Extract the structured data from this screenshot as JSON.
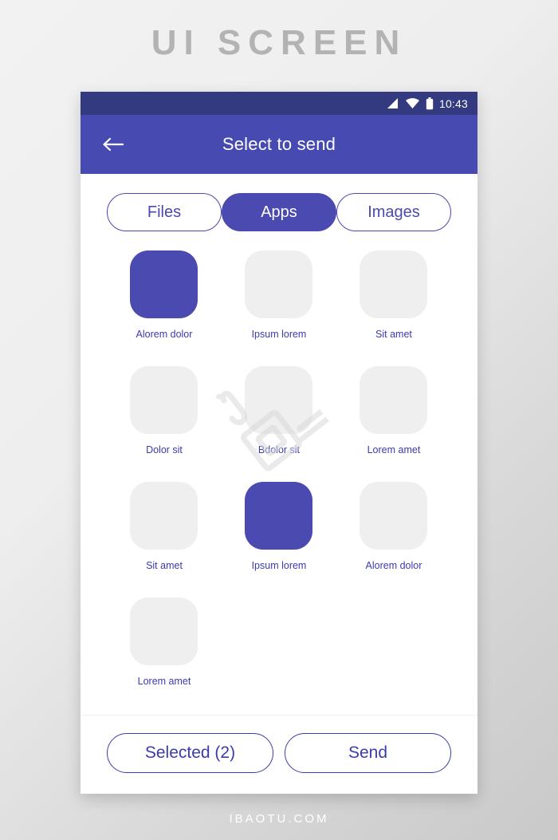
{
  "page": {
    "heading": "UI SCREEN",
    "site_watermark": "IBAOTU.COM"
  },
  "colors": {
    "status_bar": "#333a80",
    "app_bar": "#474ab0",
    "accent": "#4a4ab0",
    "label_text": "#3b3bb0",
    "tile_empty": "#efefef",
    "screen_bg": "#ffffff"
  },
  "status_bar": {
    "time": "10:43",
    "icons": [
      "signal-icon",
      "wifi-icon",
      "battery-icon"
    ]
  },
  "app_bar": {
    "title": "Select to send",
    "back_icon": "back-arrow-icon"
  },
  "tabs": [
    {
      "label": "Files",
      "selected": false
    },
    {
      "label": "Apps",
      "selected": true
    },
    {
      "label": "Images",
      "selected": false
    }
  ],
  "apps": [
    {
      "label": "Alorem dolor",
      "selected": true
    },
    {
      "label": "Ipsum lorem",
      "selected": false
    },
    {
      "label": "Sit amet",
      "selected": false
    },
    {
      "label": "Dolor sit",
      "selected": false
    },
    {
      "label": "Bdolor sit",
      "selected": false
    },
    {
      "label": "Lorem amet",
      "selected": false
    },
    {
      "label": "Sit amet",
      "selected": false
    },
    {
      "label": "Ipsum lorem",
      "selected": true
    },
    {
      "label": "Alorem dolor",
      "selected": false
    },
    {
      "label": "Lorem amet",
      "selected": false
    }
  ],
  "footer": {
    "selected_label": "Selected (2)",
    "send_label": "Send"
  }
}
